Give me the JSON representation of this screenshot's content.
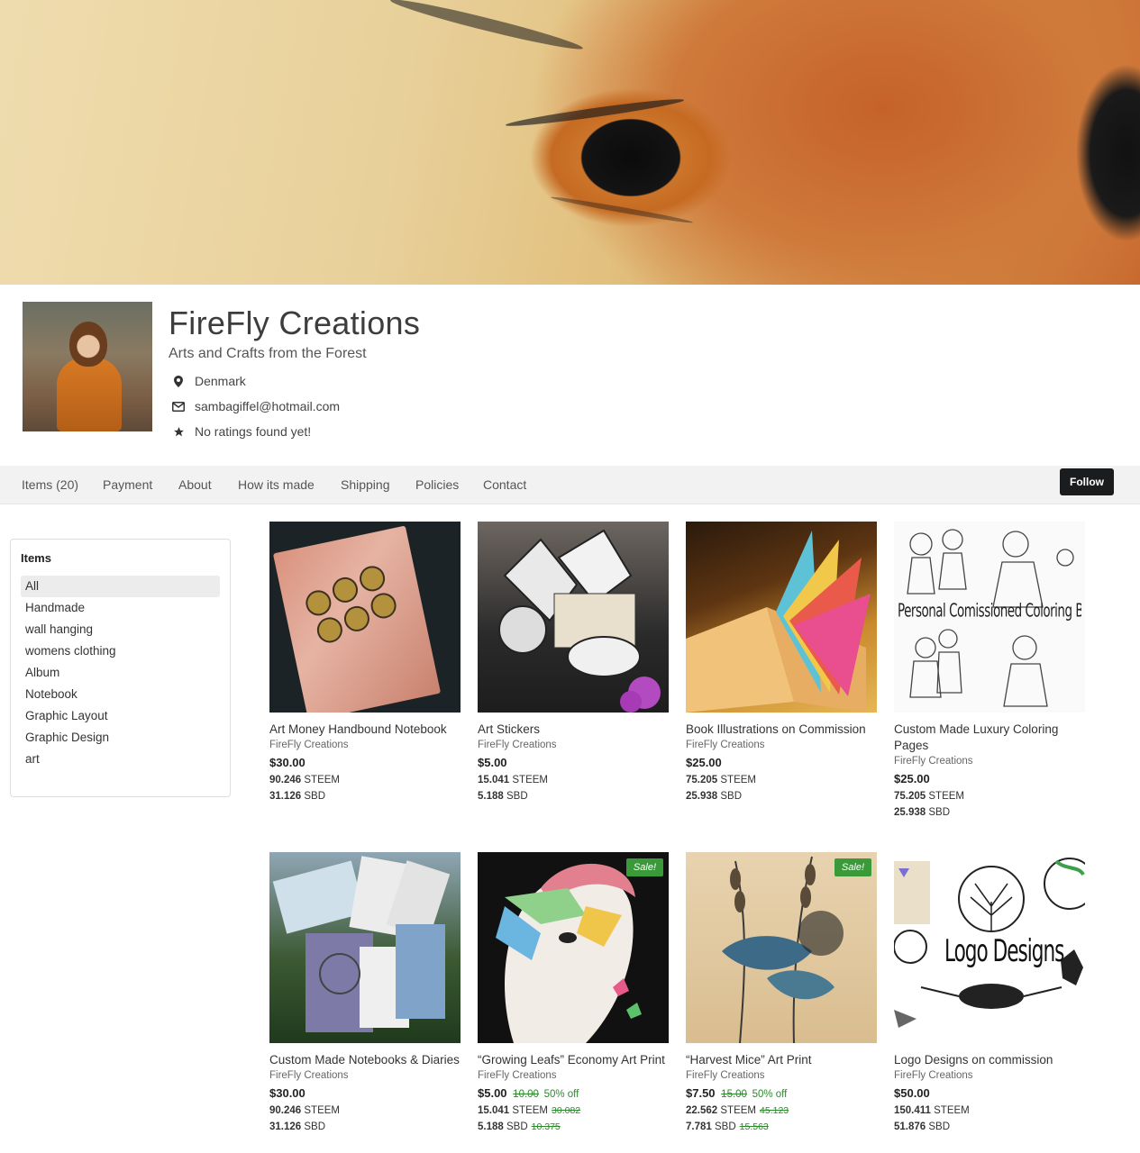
{
  "shop": {
    "name": "FireFly Creations",
    "tagline": "Arts and Crafts from the Forest",
    "location": "Denmark",
    "email": "sambagiffel@hotmail.com",
    "rating": "No ratings found yet!"
  },
  "nav": {
    "tabs": [
      "Items (20)",
      "Payment",
      "About",
      "How its made",
      "Shipping",
      "Policies",
      "Contact"
    ],
    "follow_label": "Follow"
  },
  "sidebar": {
    "heading": "Items",
    "items": [
      "All",
      "Handmade",
      "wall hanging",
      "womens clothing",
      "Album",
      "Notebook",
      "Graphic Layout",
      "Graphic Design",
      "art"
    ],
    "active": "All"
  },
  "products": [
    {
      "title": "Art Money Handbound Notebook",
      "seller": "FireFly Creations",
      "price": "$30.00",
      "steem": "90.246",
      "sbd": "31.126",
      "sale": false
    },
    {
      "title": "Art Stickers",
      "seller": "FireFly Creations",
      "price": "$5.00",
      "steem": "15.041",
      "sbd": "5.188",
      "sale": false
    },
    {
      "title": "Book Illustrations on Commission",
      "seller": "FireFly Creations",
      "price": "$25.00",
      "steem": "75.205",
      "sbd": "25.938",
      "sale": false
    },
    {
      "title": "Custom Made Luxury Coloring Pages",
      "seller": "FireFly Creations",
      "price": "$25.00",
      "steem": "75.205",
      "sbd": "25.938",
      "sale": false,
      "thumb_text": "Personal Comissioned Coloring Books"
    },
    {
      "title": "Custom Made Notebooks & Diaries",
      "seller": "FireFly Creations",
      "price": "$30.00",
      "steem": "90.246",
      "sbd": "31.126",
      "sale": false
    },
    {
      "title": "“Growing Leafs” Economy Art Print",
      "seller": "FireFly Creations",
      "price": "$5.00",
      "old_price": "10.00",
      "discount": "50% off",
      "steem": "15.041",
      "old_steem": "30.082",
      "sbd": "5.188",
      "old_sbd": "10.375",
      "sale": true
    },
    {
      "title": "“Harvest Mice” Art Print",
      "seller": "FireFly Creations",
      "price": "$7.50",
      "old_price": "15.00",
      "discount": "50% off",
      "steem": "22.562",
      "old_steem": "45.123",
      "sbd": "7.781",
      "old_sbd": "15.563",
      "sale": true
    },
    {
      "title": "Logo Designs on commission",
      "seller": "FireFly Creations",
      "price": "$50.00",
      "steem": "150.411",
      "sbd": "51.876",
      "sale": false,
      "thumb_text": "Logo Designs"
    }
  ],
  "labels": {
    "sale": "Sale!",
    "steem_unit": "STEEM",
    "sbd_unit": "SBD"
  },
  "icons": {
    "location": "map-pin-icon",
    "email": "envelope-icon",
    "rating": "star-icon"
  },
  "colors": {
    "follow_bg": "#1b1c1d",
    "sale_tag": "#3a9a3a",
    "discount_text": "#2a8a2a",
    "navbar_bg": "#f2f2f2"
  }
}
